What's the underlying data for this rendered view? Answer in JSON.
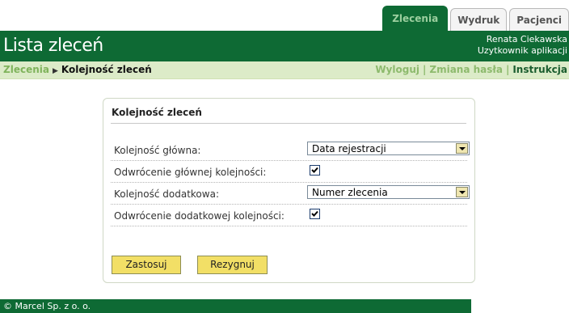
{
  "tabs": [
    {
      "label": "Zlecenia",
      "active": true
    },
    {
      "label": "Wydruk",
      "active": false
    },
    {
      "label": "Pacjenci",
      "active": false
    }
  ],
  "header": {
    "title": "Lista zleceń",
    "user_name": "Renata Ciekawska",
    "user_role": "Uzytkownik aplikacji"
  },
  "breadcrumb": {
    "parent": "Zlecenia",
    "current": "Kolejność zleceń"
  },
  "top_links": {
    "logout": "Wyloguj",
    "change_password": "Zmiana hasła",
    "instructions": "Instrukcja"
  },
  "panel": {
    "title": "Kolejność zleceń",
    "main_order_label": "Kolejność główna:",
    "main_order_value": "Data rejestracji",
    "main_reverse_label": "Odwrócenie głównej kolejności:",
    "main_reverse_checked": true,
    "extra_order_label": "Kolejność dodatkowa:",
    "extra_order_value": "Numer zlecenia",
    "extra_reverse_label": "Odwrócenie dodatkowej kolejności:",
    "extra_reverse_checked": true,
    "apply_label": "Zastosuj",
    "cancel_label": "Rezygnuj"
  },
  "footer": {
    "copyright": "© Marcel Sp. z o. o."
  },
  "colors": {
    "brand_green": "#0e6a34",
    "nav_bg": "#dcebc8",
    "button_yellow": "#f2df66"
  }
}
